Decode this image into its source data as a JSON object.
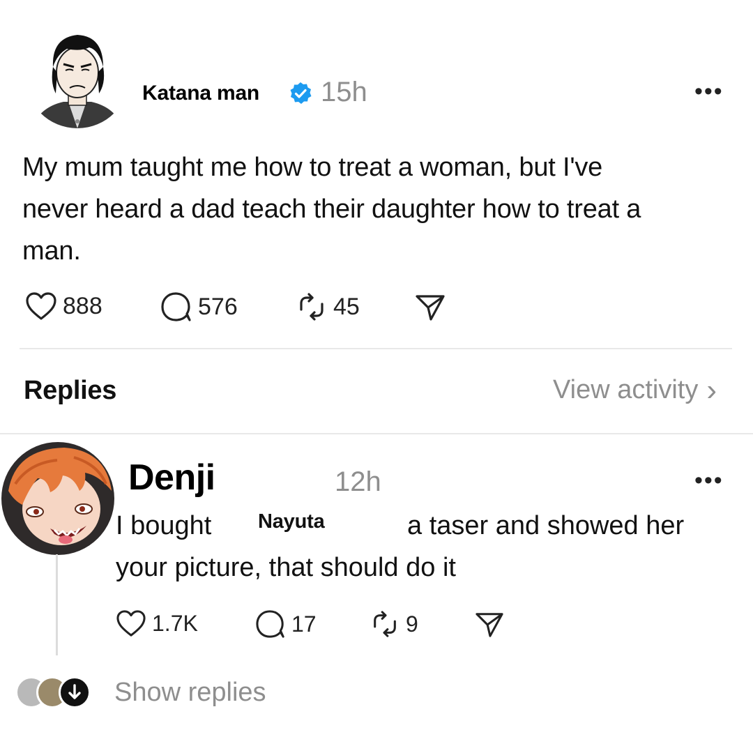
{
  "post": {
    "author": "Katana man",
    "time": "15h",
    "text_line1": "My mum taught me how to treat a woman, but I've",
    "text_line2": "never heard a dad teach their daughter how to treat a",
    "text_line3": "man.",
    "likes": "888",
    "comments": "576",
    "reposts": "45"
  },
  "section": {
    "replies_label": "Replies",
    "view_activity": "View activity",
    "chevron": "›"
  },
  "reply": {
    "author": "Denji",
    "time": "12h",
    "text_part1": "I bought",
    "overlay_name": "Nayuta",
    "text_part2": "a taser and showed her",
    "text_line2": "your picture, that should do it",
    "likes": "1.7K",
    "comments": "17",
    "reposts": "9",
    "show_replies": "Show replies"
  },
  "icons": {
    "more": "more-icon",
    "heart": "heart-icon",
    "comment": "comment-icon",
    "repost": "repost-icon",
    "share": "share-icon",
    "verified": "verified-badge-icon",
    "down_arrow": "arrow-down-icon"
  },
  "colors": {
    "verified": "#1d9bf0",
    "muted": "#8e8e8e",
    "divider": "#e8e8e8"
  }
}
